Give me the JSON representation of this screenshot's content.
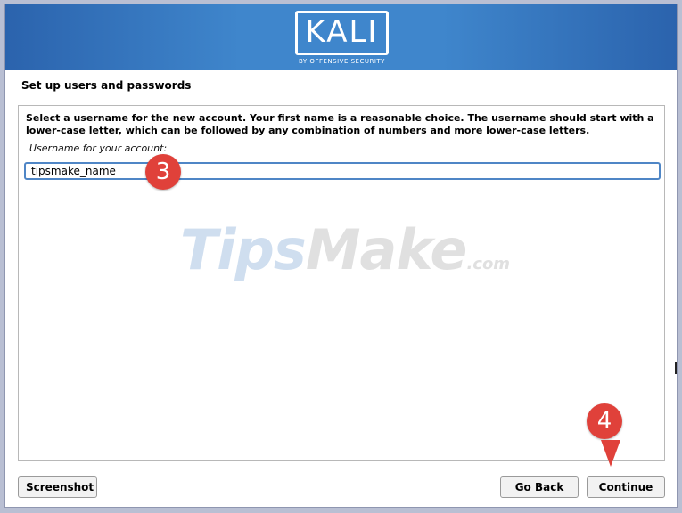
{
  "header": {
    "logo_text": "KALI",
    "logo_subtitle": "BY OFFENSIVE SECURITY"
  },
  "page": {
    "title": "Set up users and passwords"
  },
  "form": {
    "instructions": "Select a username for the new account. Your first name is a reasonable choice. The username should start with a lower-case letter, which can be followed by any combination of numbers and more lower-case letters.",
    "username_label": "Username for your account:",
    "username_value": "tipsmake_name"
  },
  "watermark": {
    "part1": "Tips",
    "part2": "Make",
    "part3": ".com"
  },
  "annotations": {
    "step3": "3",
    "step4": "4"
  },
  "footer": {
    "screenshot_label": "Screenshot",
    "back_label": "Go Back",
    "continue_label": "Continue"
  },
  "colors": {
    "banner": "#3f86cc",
    "accent_red": "#e0413a",
    "input_border": "#4f86c6"
  }
}
